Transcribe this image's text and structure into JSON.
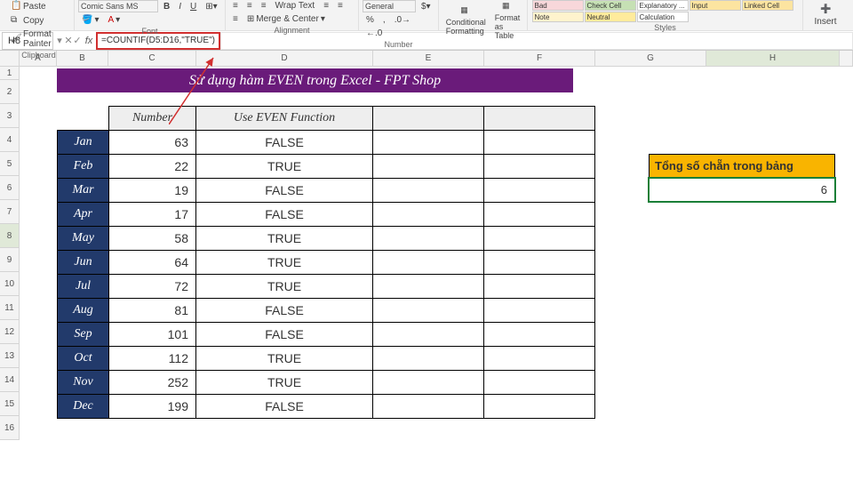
{
  "ribbon": {
    "paste": "Paste",
    "copy": "Copy",
    "format_painter": "Format Painter",
    "clipboard_label": "Clipboard",
    "font_label": "Font",
    "alignment_label": "Alignment",
    "number_label": "Number",
    "merge_center": "Merge & Center",
    "wrap_text": "Wrap Text",
    "number_format": "General",
    "conditional_formatting": "Conditional Formatting",
    "format_table": "Format as Table",
    "styles_label": "Styles",
    "insert": "Insert",
    "cell_styles": [
      "Bad",
      "Check Cell",
      "Explanatory ...",
      "Input",
      "Linked Cell",
      "Note",
      "Neutral",
      "Calculation"
    ],
    "font_name": "Comic Sans MS"
  },
  "formula_bar": {
    "name_box": "H8",
    "formula": "=COUNTIF(D5:D16,\"TRUE\")"
  },
  "columns": [
    "A",
    "B",
    "C",
    "D",
    "E",
    "F",
    "G",
    "H",
    ""
  ],
  "rows": [
    "1",
    "2",
    "3",
    "4",
    "5",
    "6",
    "7",
    "8",
    "9",
    "10",
    "11",
    "12",
    "13",
    "14",
    "15",
    "16"
  ],
  "banner": "Sử dụng hàm EVEN trong Excel - FPT Shop",
  "table": {
    "headers": {
      "number": "Number",
      "even": "Use EVEN Function"
    },
    "rows": [
      {
        "month": "Jan",
        "number": "63",
        "even": "FALSE"
      },
      {
        "month": "Feb",
        "number": "22",
        "even": "TRUE"
      },
      {
        "month": "Mar",
        "number": "19",
        "even": "FALSE"
      },
      {
        "month": "Apr",
        "number": "17",
        "even": "FALSE"
      },
      {
        "month": "May",
        "number": "58",
        "even": "TRUE"
      },
      {
        "month": "Jun",
        "number": "64",
        "even": "TRUE"
      },
      {
        "month": "Jul",
        "number": "72",
        "even": "TRUE"
      },
      {
        "month": "Aug",
        "number": "81",
        "even": "FALSE"
      },
      {
        "month": "Sep",
        "number": "101",
        "even": "FALSE"
      },
      {
        "month": "Oct",
        "number": "112",
        "even": "TRUE"
      },
      {
        "month": "Nov",
        "number": "252",
        "even": "TRUE"
      },
      {
        "month": "Dec",
        "number": "199",
        "even": "FALSE"
      }
    ]
  },
  "sidebox": {
    "title": "Tổng số chẵn trong bảng",
    "value": "6"
  }
}
